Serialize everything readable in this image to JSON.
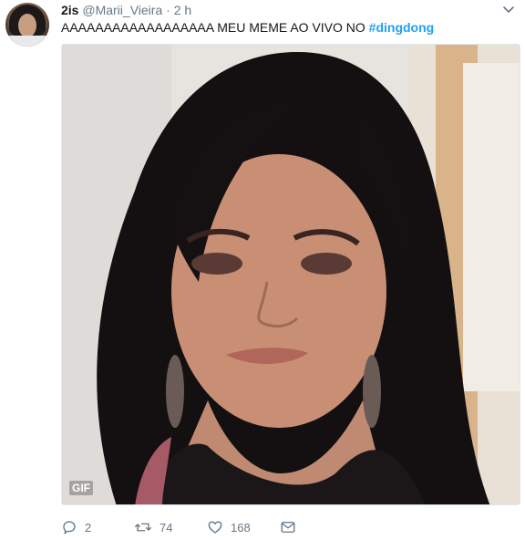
{
  "tweet": {
    "display_name": "2is",
    "handle": "@Marii_Vieira",
    "separator": "·",
    "time": "2 h",
    "text": "AAAAAAAAAAAAAAAAAA MEU MEME AO VIVO NO ",
    "hashtag": "#dingdong",
    "media_badge": "GIF"
  },
  "actions": {
    "reply_count": "2",
    "retweet_count": "74",
    "like_count": "168"
  },
  "icons": {
    "caret": "chevron-down-icon",
    "reply": "reply-icon",
    "retweet": "retweet-icon",
    "like": "heart-icon",
    "message": "envelope-icon"
  },
  "colors": {
    "link": "#1da1f2",
    "muted": "#657786",
    "text": "#14171a"
  }
}
